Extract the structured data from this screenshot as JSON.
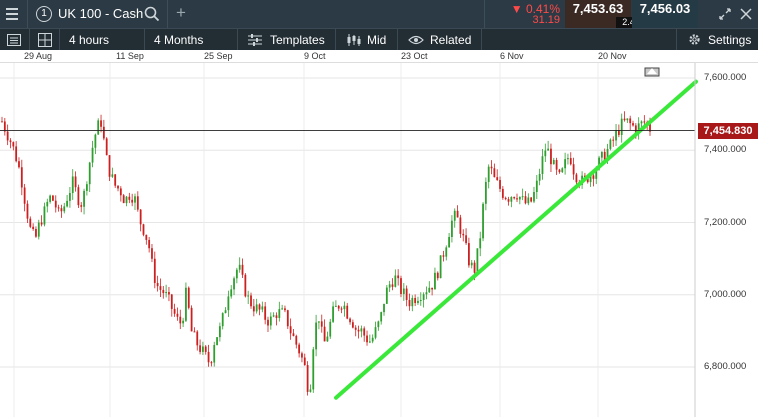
{
  "instrument": {
    "badge": "1",
    "name": "UK 100 - Cash",
    "add_symbol": "+"
  },
  "quote": {
    "change_pct": "▼ 0.41%",
    "change_pts": "31.19",
    "sell": "7,453.63",
    "buy": "7,456.03",
    "spread": "2.40"
  },
  "toolbar": {
    "interval": "4 hours",
    "range": "4 Months",
    "templates": "Templates",
    "price_type": "Mid",
    "related": "Related",
    "settings": "Settings"
  },
  "axis": {
    "dates": [
      "29 Aug",
      "11 Sep",
      "25 Sep",
      "9 Oct",
      "23 Oct",
      "6 Nov",
      "20 Nov"
    ],
    "prices": [
      "7,600.000",
      "7,400.000",
      "7,200.000",
      "7,000.000",
      "6,800.000"
    ],
    "current_price": "7,454.830"
  },
  "colors": {
    "up": "#2e9e2e",
    "down": "#cc2020",
    "trendline": "#3ae83a",
    "price_tag": "#a81818"
  },
  "chart_data": {
    "type": "candlestick",
    "y_range": [
      6680,
      7680
    ],
    "current_price": 7454.83,
    "trendline": {
      "from": {
        "x": "9 Oct",
        "y": 6715
      },
      "to": {
        "x": "after 20 Nov",
        "y": 7590
      }
    },
    "path": [
      7480,
      7450,
      7420,
      7380,
      7330,
      7250,
      7180,
      7150,
      7200,
      7230,
      7270,
      7260,
      7220,
      7240,
      7280,
      7310,
      7270,
      7250,
      7330,
      7400,
      7460,
      7480,
      7380,
      7330,
      7300,
      7290,
      7260,
      7280,
      7270,
      7210,
      7180,
      7140,
      7060,
      7020,
      7010,
      6990,
      6960,
      6930,
      6920,
      7010,
      6900,
      6870,
      6850,
      6830,
      6810,
      6880,
      6900,
      6950,
      7020,
      7050,
      7080,
      7030,
      6990,
      6970,
      6960,
      6950,
      6930,
      6930,
      6950,
      6950,
      6940,
      6900,
      6870,
      6840,
      6800,
      6720,
      6900,
      6940,
      6860,
      6900,
      6950,
      6970,
      6980,
      6950,
      6930,
      6900,
      6900,
      6880,
      6870,
      6900,
      6930,
      7000,
      7030,
      7050,
      7020,
      7000,
      6980,
      6990,
      7000,
      7010,
      7020,
      7030,
      7060,
      7100,
      7150,
      7200,
      7220,
      7180,
      7130,
      7080,
      7070,
      7150,
      7280,
      7360,
      7320,
      7300,
      7280,
      7270,
      7280,
      7280,
      7260,
      7250,
      7260,
      7300,
      7360,
      7410,
      7380,
      7340,
      7320,
      7360,
      7390,
      7340,
      7320,
      7310,
      7330,
      7340,
      7360,
      7380,
      7400,
      7420,
      7450,
      7470,
      7480,
      7470,
      7460,
      7470,
      7480,
      7460
    ]
  }
}
